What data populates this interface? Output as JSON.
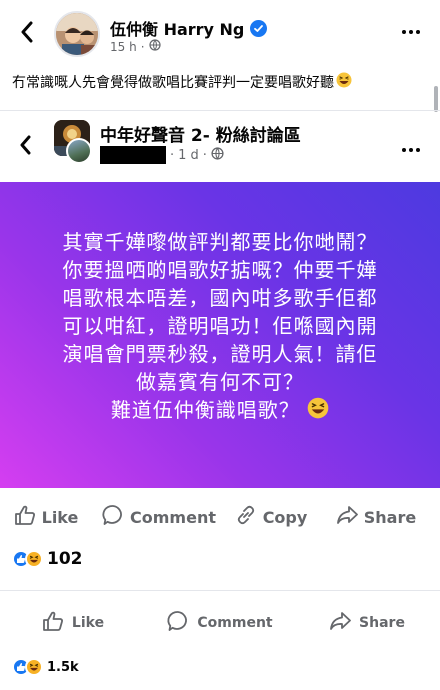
{
  "post": {
    "author": "伍仲衡 Harry Ng",
    "time": "15 h",
    "caption": "冇常識嘅人先會覺得做歌唱比賽評判一定要唱歌好聽"
  },
  "shared_post": {
    "group_name": "中年好聲音 2- 粉絲討論區",
    "time": "1 d",
    "text_lines": [
      "其實千嬅嚟做評判都要比你哋鬧？",
      "你要搵哂啲唱歌好掂嘅？仲要千嬅",
      "唱歌根本唔差，國內咁多歌手佢都",
      "可以咁紅，證明唱功！佢喺國內開",
      "演唱會門票秒殺，證明人氣！請佢",
      "做嘉賓有何不可？",
      "難道伍仲衡識唱歌？"
    ],
    "gradient_colors": [
      "#d53ef0",
      "#9a35ea",
      "#6a34e6",
      "#4d3ae0"
    ],
    "actions": {
      "like": "Like",
      "comment": "Comment",
      "copy": "Copy",
      "share": "Share"
    },
    "reaction_count": "102"
  },
  "outer_actions": {
    "like": "Like",
    "comment": "Comment",
    "share": "Share"
  },
  "outer_reaction_count": "1.5k",
  "colors": {
    "accent": "#1877f2",
    "secondary_text": "#65676b",
    "haha": "#f7b125"
  },
  "icons": [
    "back-arrow-icon",
    "verified-badge-icon",
    "globe-icon",
    "more-dots-icon",
    "laughing-emoji-icon",
    "like-thumb-icon",
    "comment-bubble-icon",
    "copy-link-icon",
    "share-arrow-icon",
    "like-reaction-icon",
    "haha-reaction-icon"
  ]
}
